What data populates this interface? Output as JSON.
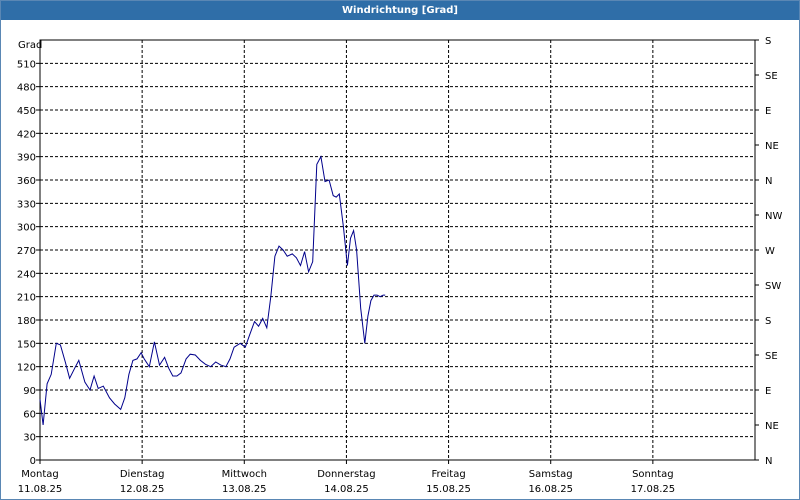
{
  "window": {
    "title": "Windrichtung [Grad]"
  },
  "colors": {
    "titlebar": "#2f6ea8",
    "line": "#00008b",
    "grid": "#000000"
  },
  "chart_data": {
    "type": "line",
    "title": "Windrichtung [Grad]",
    "ylabel": "Grad",
    "ylim": [
      0,
      540
    ],
    "grid": true,
    "y_ticks": [
      0,
      30,
      60,
      90,
      120,
      150,
      180,
      210,
      240,
      270,
      300,
      330,
      360,
      390,
      420,
      450,
      480,
      510
    ],
    "right_ticks": [
      {
        "value": 0,
        "label": "N"
      },
      {
        "value": 30,
        "label": "NE"
      },
      {
        "value": 60,
        "label": "E"
      },
      {
        "value": 90,
        "label": "SE"
      },
      {
        "value": 120,
        "label": "S"
      },
      {
        "value": 150,
        "label": "SW"
      },
      {
        "value": 180,
        "label": "W"
      },
      {
        "value": 210,
        "label": "NW"
      },
      {
        "value": 240,
        "label": "N"
      },
      {
        "value": 270,
        "label": "NE"
      },
      {
        "value": 300,
        "label": "E"
      },
      {
        "value": 330,
        "label": "SE"
      },
      {
        "value": 360,
        "label": "S"
      }
    ],
    "x_ticks": [
      {
        "day": "Montag",
        "date": "11.08.25"
      },
      {
        "day": "Dienstag",
        "date": "12.08.25"
      },
      {
        "day": "Mittwoch",
        "date": "13.08.25"
      },
      {
        "day": "Donnerstag",
        "date": "14.08.25"
      },
      {
        "day": "Freitag",
        "date": "15.08.25"
      },
      {
        "day": "Samstag",
        "date": "16.08.25"
      },
      {
        "day": "Sonntag",
        "date": "17.08.25"
      }
    ],
    "xlim_days": [
      0,
      7
    ],
    "series": [
      {
        "x": [
          0,
          0.03,
          0.07,
          0.11,
          0.16,
          0.2,
          0.25,
          0.29,
          0.34,
          0.38,
          0.44,
          0.49,
          0.53,
          0.57,
          0.62,
          0.68,
          0.73,
          0.79,
          0.83,
          0.87,
          0.91,
          0.95,
          0.99,
          1.02,
          1.07,
          1.12,
          1.17,
          1.22,
          1.26,
          1.3,
          1.34,
          1.38,
          1.43,
          1.47,
          1.52,
          1.57,
          1.62,
          1.67,
          1.72,
          1.77,
          1.82,
          1.86,
          1.9,
          1.96,
          2.01,
          2.05,
          2.1,
          2.14,
          2.18,
          2.22,
          2.26,
          2.3,
          2.34,
          2.38,
          2.42,
          2.47,
          2.51,
          2.55,
          2.59,
          2.63,
          2.67,
          2.71,
          2.75,
          2.79,
          2.83,
          2.87,
          2.9,
          2.93,
          2.97,
          3.01,
          3.04,
          3.07,
          3.1,
          3.14,
          3.18,
          3.21,
          3.24,
          3.27,
          3.3,
          3.33,
          3.36,
          3.38
        ],
        "y": [
          78,
          45,
          98,
          110,
          150,
          148,
          125,
          105,
          118,
          128,
          100,
          90,
          108,
          92,
          95,
          80,
          72,
          65,
          80,
          110,
          128,
          130,
          138,
          130,
          120,
          152,
          122,
          132,
          118,
          108,
          108,
          112,
          130,
          136,
          135,
          128,
          123,
          120,
          126,
          122,
          120,
          130,
          145,
          150,
          145,
          160,
          178,
          172,
          182,
          170,
          210,
          262,
          275,
          270,
          262,
          265,
          260,
          250,
          268,
          242,
          255,
          380,
          390,
          358,
          360,
          340,
          338,
          342,
          300,
          250,
          285,
          295,
          270,
          195,
          150,
          185,
          205,
          212,
          212,
          210,
          212,
          212
        ]
      }
    ]
  }
}
